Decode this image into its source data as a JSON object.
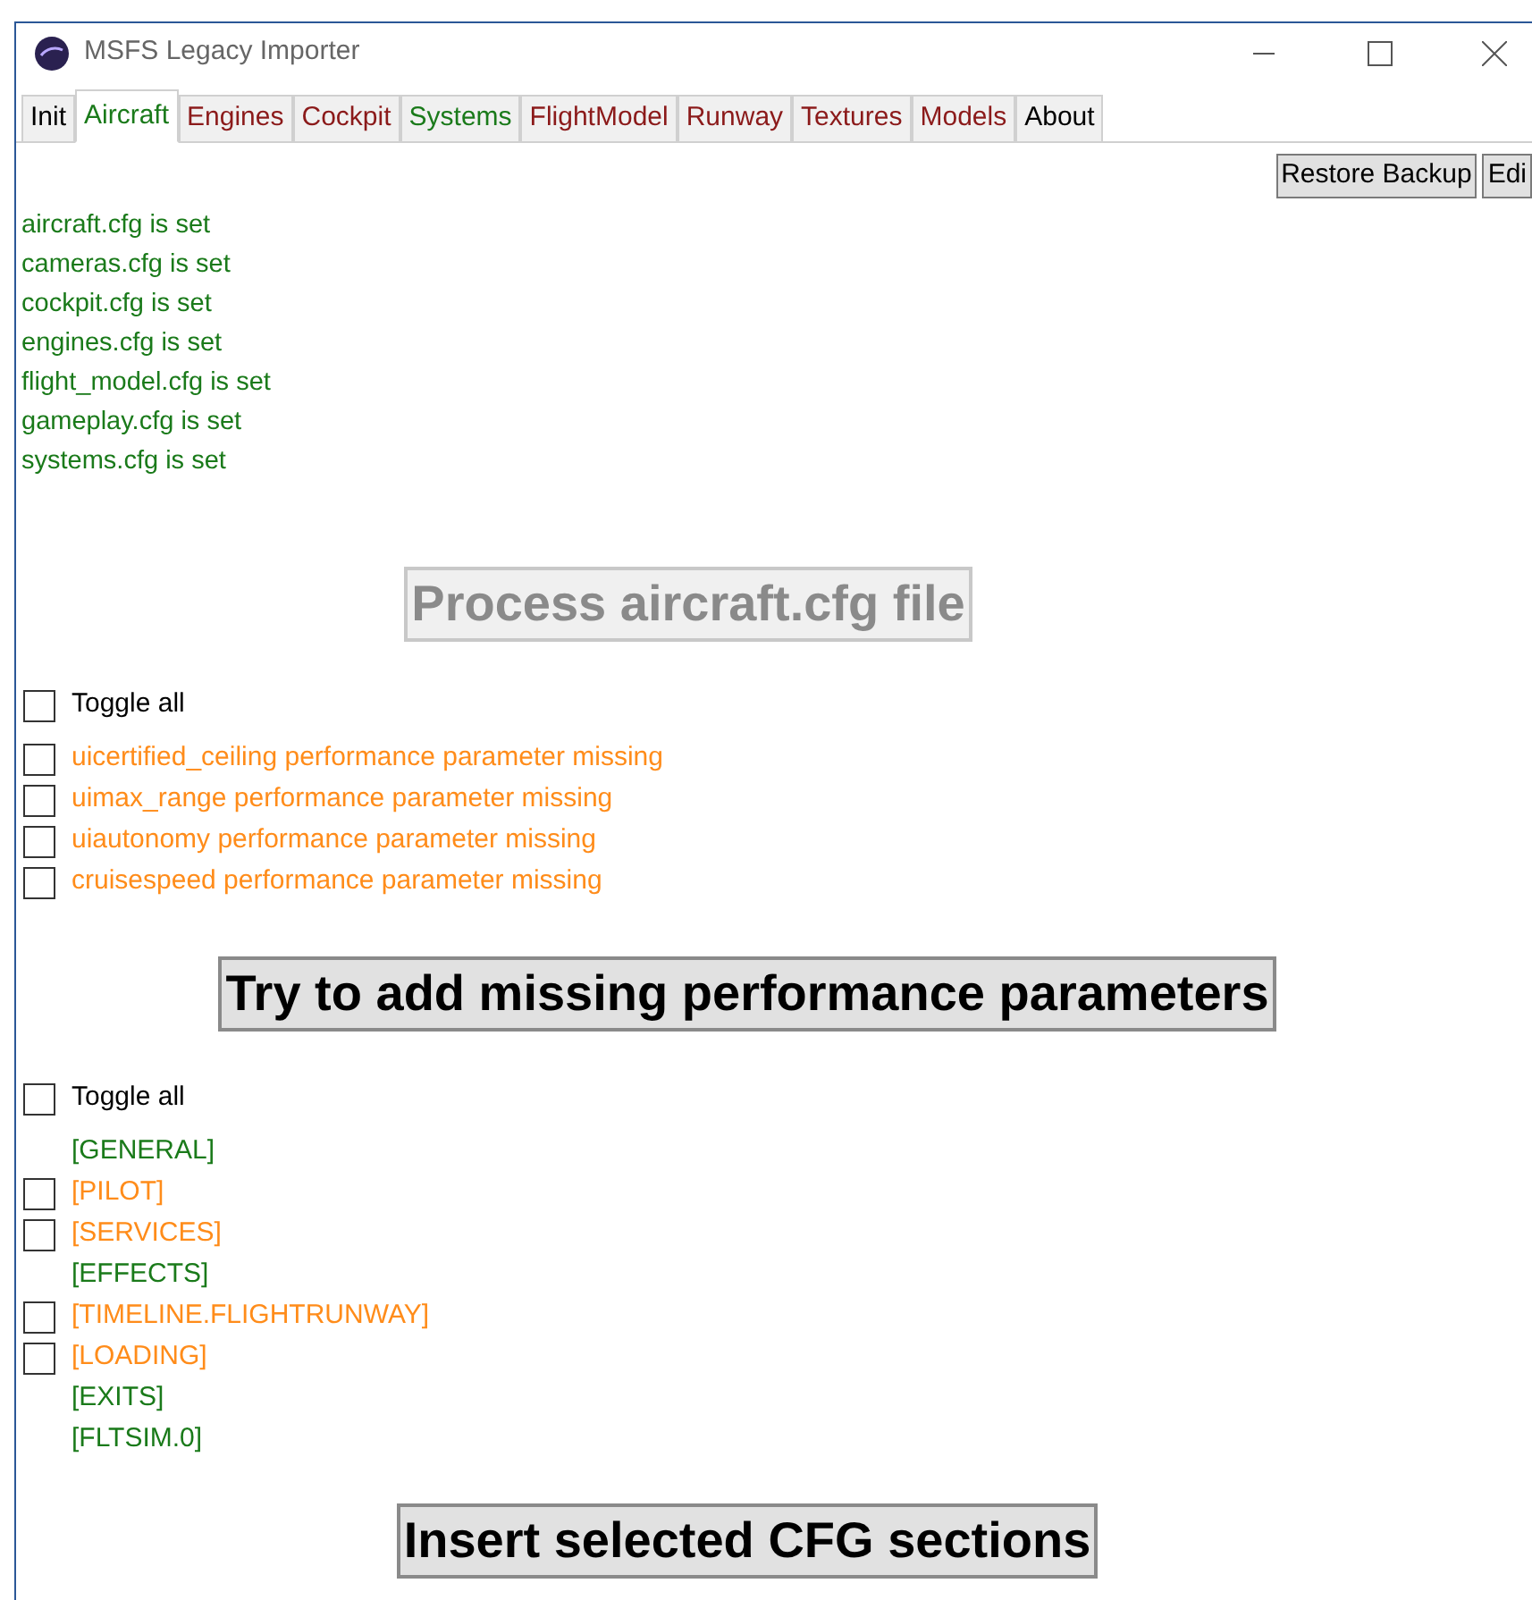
{
  "window": {
    "title": "MSFS Legacy Importer"
  },
  "tabs": [
    {
      "label": "Init",
      "selected": false,
      "color": "#000000"
    },
    {
      "label": "Aircraft",
      "selected": true,
      "color": "#1a7a1a"
    },
    {
      "label": "Engines",
      "selected": false,
      "color": "#8b1a1a"
    },
    {
      "label": "Cockpit",
      "selected": false,
      "color": "#8b1a1a"
    },
    {
      "label": "Systems",
      "selected": false,
      "color": "#1a7a1a"
    },
    {
      "label": "FlightModel",
      "selected": false,
      "color": "#8b1a1a"
    },
    {
      "label": "Runway",
      "selected": false,
      "color": "#8b1a1a"
    },
    {
      "label": "Textures",
      "selected": false,
      "color": "#8b1a1a"
    },
    {
      "label": "Models",
      "selected": false,
      "color": "#8b1a1a"
    },
    {
      "label": "About",
      "selected": false,
      "color": "#000000"
    }
  ],
  "toolbar_buttons": [
    "Restore Backup",
    "Edi"
  ],
  "file_status": [
    "aircraft.cfg is set",
    "cameras.cfg is set",
    "cockpit.cfg is set",
    "engines.cfg is set",
    "flight_model.cfg is set",
    "gameplay.cfg is set",
    "systems.cfg is set"
  ],
  "process_button": {
    "label": "Process aircraft.cfg file",
    "disabled": true
  },
  "performance": {
    "toggle_all": {
      "label": "Toggle all",
      "checked": false
    },
    "items": [
      {
        "label": "uicertified_ceiling performance parameter missing",
        "checked": false
      },
      {
        "label": "uimax_range performance parameter missing",
        "checked": false
      },
      {
        "label": "uiautonomy performance parameter missing",
        "checked": false
      },
      {
        "label": "cruisespeed performance parameter missing",
        "checked": false
      }
    ],
    "button": {
      "label": "Try to add missing performance parameters",
      "disabled": false
    }
  },
  "sections": {
    "toggle_all": {
      "label": "Toggle all",
      "checked": false
    },
    "items": [
      {
        "label": "[GENERAL]",
        "kind": "present"
      },
      {
        "label": "[PILOT]",
        "kind": "missing",
        "checked": false
      },
      {
        "label": "[SERVICES]",
        "kind": "missing",
        "checked": false
      },
      {
        "label": "[EFFECTS]",
        "kind": "present"
      },
      {
        "label": "[TIMELINE.FLIGHTRUNWAY]",
        "kind": "missing",
        "checked": false
      },
      {
        "label": "[LOADING]",
        "kind": "missing",
        "checked": false
      },
      {
        "label": "[EXITS]",
        "kind": "present"
      },
      {
        "label": "[FLTSIM.0]",
        "kind": "present"
      }
    ],
    "button": {
      "label": "Insert selected CFG sections",
      "disabled": false
    }
  }
}
